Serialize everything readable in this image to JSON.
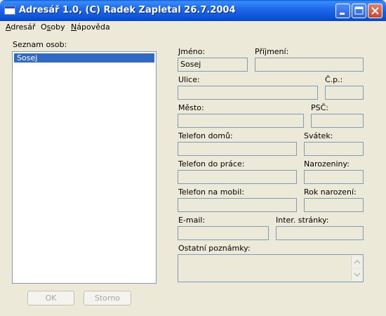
{
  "window": {
    "title": "Adresář 1.0, (C) Radek Zapletal 26.7.2004",
    "icon": "app-window-icon",
    "controls": [
      "minimize-icon",
      "maximize-icon",
      "close-icon"
    ]
  },
  "menu": {
    "items": [
      {
        "label": "Adresář"
      },
      {
        "label": "Osoby"
      },
      {
        "label": "Nápověda"
      }
    ]
  },
  "person_list": {
    "label": "Seznam osob:",
    "items": [
      "Sosej"
    ],
    "selected_index": 0
  },
  "form": {
    "jmeno": {
      "label": "Jméno:",
      "value": "Sosej"
    },
    "prijmeni": {
      "label": "Příjmení:",
      "value": ""
    },
    "ulice": {
      "label": "Ulice:",
      "value": ""
    },
    "cp": {
      "label": "Č.p.:",
      "value": ""
    },
    "mesto": {
      "label": "Město:",
      "value": ""
    },
    "psc": {
      "label": "PSČ:",
      "value": ""
    },
    "telefon_domu": {
      "label": "Telefon domů:",
      "value": ""
    },
    "svatek": {
      "label": "Svátek:",
      "value": ""
    },
    "telefon_prace": {
      "label": "Telefon do práce:",
      "value": ""
    },
    "narozeniny": {
      "label": "Narozeniny:",
      "value": ""
    },
    "telefon_mobil": {
      "label": "Telefon na mobil:",
      "value": ""
    },
    "rok_narozeni": {
      "label": "Rok narození:",
      "value": ""
    },
    "email": {
      "label": "E-mail:",
      "value": ""
    },
    "stranky": {
      "label": "Inter. stránky:",
      "value": ""
    },
    "poznamky": {
      "label": "Ostatní poznámky:",
      "value": ""
    }
  },
  "buttons": {
    "ok": "OK",
    "storno": "Storno"
  }
}
